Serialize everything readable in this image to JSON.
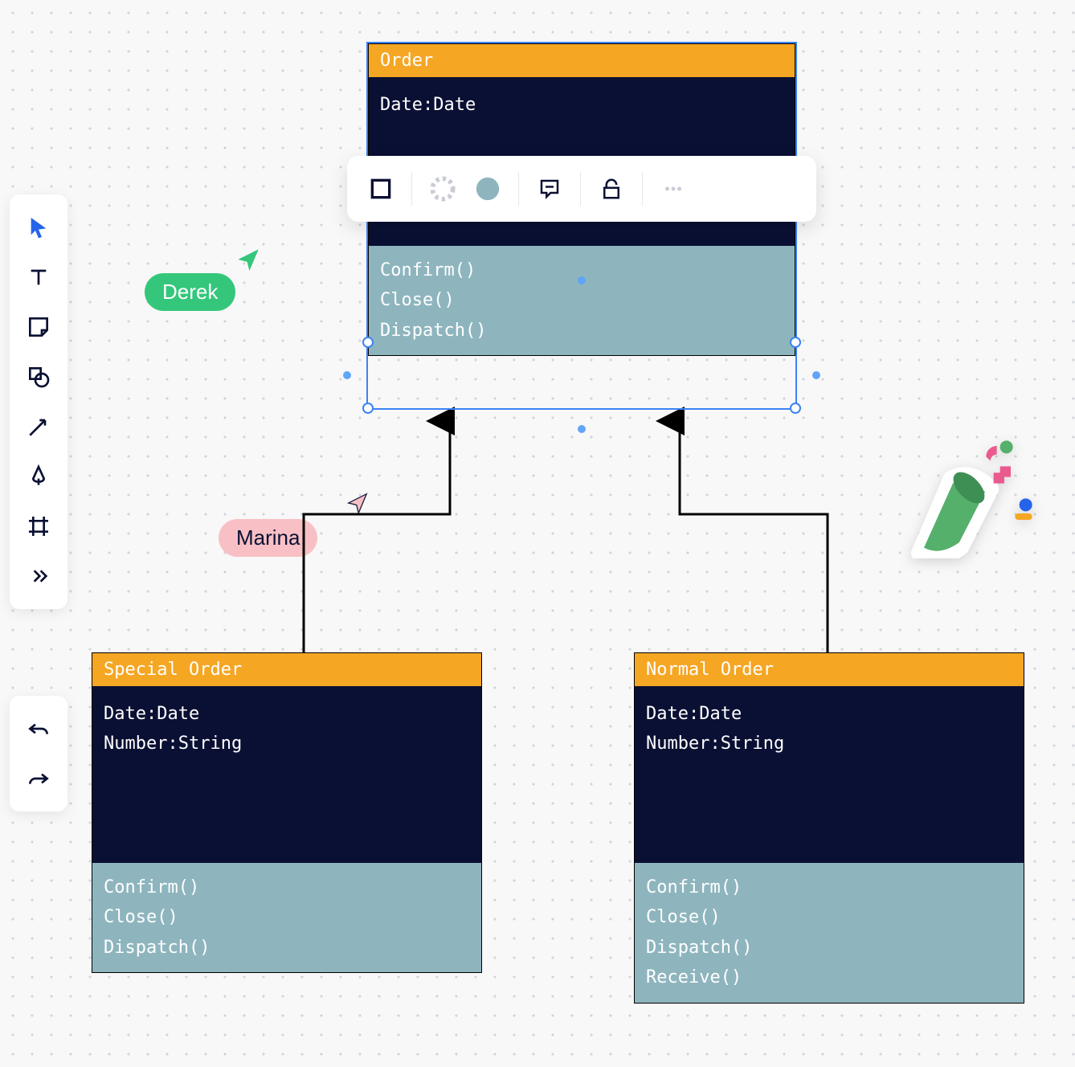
{
  "collaborators": [
    {
      "name": "Derek",
      "color": "#34c77b"
    },
    {
      "name": "Marina",
      "color": "#f8c0c5"
    }
  ],
  "toolbar": {
    "tools": [
      "cursor",
      "text",
      "sticky-note",
      "shape",
      "arrow",
      "pen",
      "frame",
      "more"
    ],
    "undo": "undo",
    "redo": "redo"
  },
  "context_bar": {
    "items": [
      "square-outline",
      "border-dashed",
      "fill-color",
      "comment",
      "unlock",
      "more"
    ]
  },
  "uml": {
    "order": {
      "title": "Order",
      "attributes": [
        "Date:Date"
      ],
      "methods": [
        "Confirm()",
        "Close()",
        "Dispatch()"
      ]
    },
    "special": {
      "title": "Special Order",
      "attributes": [
        "Date:Date",
        "Number:String"
      ],
      "methods": [
        "Confirm()",
        "Close()",
        "Dispatch()"
      ]
    },
    "normal": {
      "title": "Normal Order",
      "attributes": [
        "Date:Date",
        "Number:String"
      ],
      "methods": [
        "Confirm()",
        "Close()",
        "Dispatch()",
        "Receive()"
      ]
    }
  },
  "chart_data": {
    "type": "diagram",
    "diagram_type": "uml-class",
    "classes": [
      {
        "id": "order",
        "name": "Order",
        "attributes": [
          "Date:Date"
        ],
        "methods": [
          "Confirm()",
          "Close()",
          "Dispatch()"
        ]
      },
      {
        "id": "special",
        "name": "Special Order",
        "attributes": [
          "Date:Date",
          "Number:String"
        ],
        "methods": [
          "Confirm()",
          "Close()",
          "Dispatch()"
        ]
      },
      {
        "id": "normal",
        "name": "Normal Order",
        "attributes": [
          "Date:Date",
          "Number:String"
        ],
        "methods": [
          "Confirm()",
          "Close()",
          "Dispatch()",
          "Receive()"
        ]
      }
    ],
    "relationships": [
      {
        "from": "special",
        "to": "order",
        "type": "inheritance"
      },
      {
        "from": "normal",
        "to": "order",
        "type": "inheritance"
      }
    ],
    "selected": "order"
  }
}
